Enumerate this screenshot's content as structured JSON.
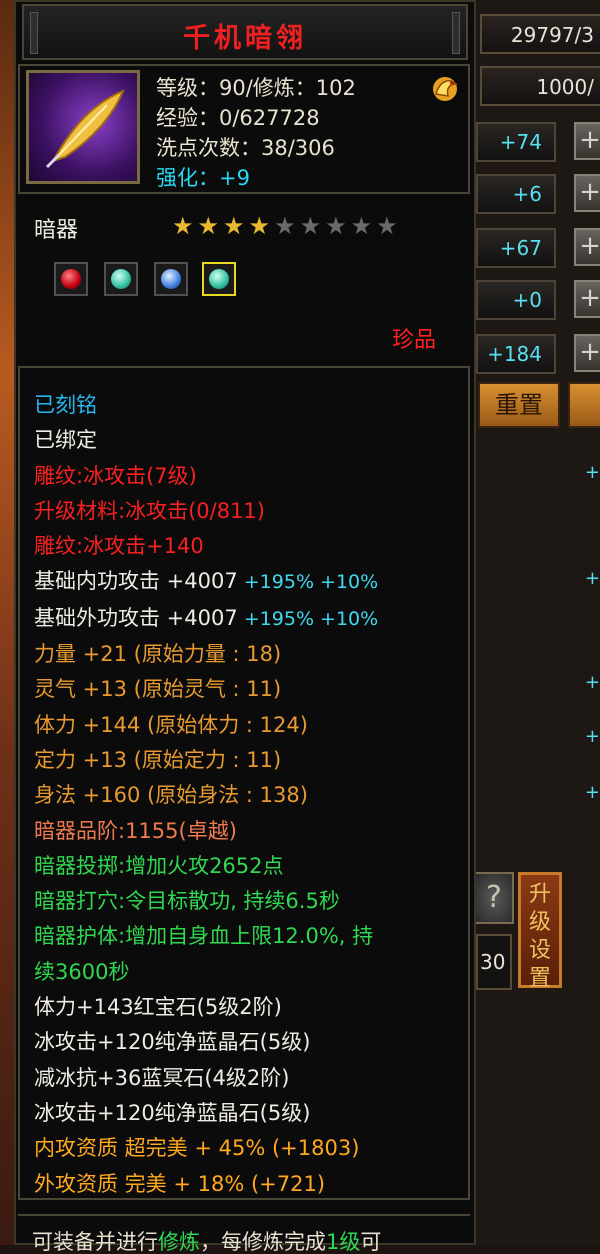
{
  "tooltip": {
    "title": "千机暗翎",
    "info": {
      "level": "等级：90/修炼：102",
      "exp": "经验：0/627728",
      "wash": "洗点次数：38/306",
      "enhance": "强化：+9"
    },
    "category": "暗器",
    "stars": {
      "filled": 4,
      "total": 9
    },
    "gems": [
      "ruby",
      "emerald",
      "sapphire",
      "emerald"
    ],
    "rarity": "珍品",
    "lines": [
      {
        "text": "已刻铭",
        "color": "cyan"
      },
      {
        "text": "已绑定",
        "color": "white"
      },
      {
        "text": "雕纹:冰攻击(7级)",
        "color": "red"
      },
      {
        "text": "升级材料:冰攻击(0/811)",
        "color": "red"
      },
      {
        "text": "雕纹:冰攻击+140",
        "color": "red"
      },
      {
        "text": "基础内功攻击 +4007",
        "extra": " +195% +10%",
        "color": "white"
      },
      {
        "text": "基础外功攻击 +4007",
        "extra": " +195% +10%",
        "color": "white"
      },
      {
        "text": "力量 +21 (原始力量 : 18)",
        "color": "orange"
      },
      {
        "text": "灵气 +13 (原始灵气 : 11)",
        "color": "orange"
      },
      {
        "text": "体力 +144 (原始体力 : 124)",
        "color": "orange"
      },
      {
        "text": "定力 +13 (原始定力 : 11)",
        "color": "orange"
      },
      {
        "text": "身法 +160 (原始身法 : 138)",
        "color": "orange"
      },
      {
        "text": "暗器品阶:1155(卓越)",
        "color": "salmon"
      },
      {
        "text": "暗器投掷:增加火攻2652点",
        "color": "green"
      },
      {
        "text": "暗器打穴:令目标散功, 持续6.5秒",
        "color": "green"
      },
      {
        "text": "暗器护体:增加自身血上限12.0%, 持",
        "color": "green"
      },
      {
        "text": "续3600秒",
        "color": "green"
      },
      {
        "text": "体力+143红宝石(5级2阶)",
        "color": "white"
      },
      {
        "text": "冰攻击+120纯净蓝晶石(5级)",
        "color": "white"
      },
      {
        "text": "减冰抗+36蓝冥石(4级2阶)",
        "color": "white"
      },
      {
        "text": "冰攻击+120纯净蓝晶石(5级)",
        "color": "white"
      },
      {
        "text": "内攻资质 超完美 + 45% (+1803)",
        "color": "gold"
      },
      {
        "text": "外攻资质 完美 + 18% (+721)",
        "color": "gold"
      }
    ],
    "footer": {
      "pre": "可装备并进行",
      "hl": "修炼",
      "post": "，每修炼完成",
      "hl2": "1级",
      "post2": "可"
    }
  },
  "right_panel": {
    "top_value": "29797/3",
    "second_value": "1000/",
    "stat_values": [
      "+74",
      "+6",
      "+67",
      "+0",
      "+184"
    ],
    "reset_label": "重置",
    "upgrade_label": "升级设置",
    "help_label": "?",
    "side_number": "30"
  },
  "colors": {
    "title": "#f02020",
    "cyan": "#28b8f0",
    "red": "#f82020",
    "orange": "#e89a30",
    "green": "#30d850",
    "gold": "#ffa820",
    "star": "#e8b830"
  }
}
